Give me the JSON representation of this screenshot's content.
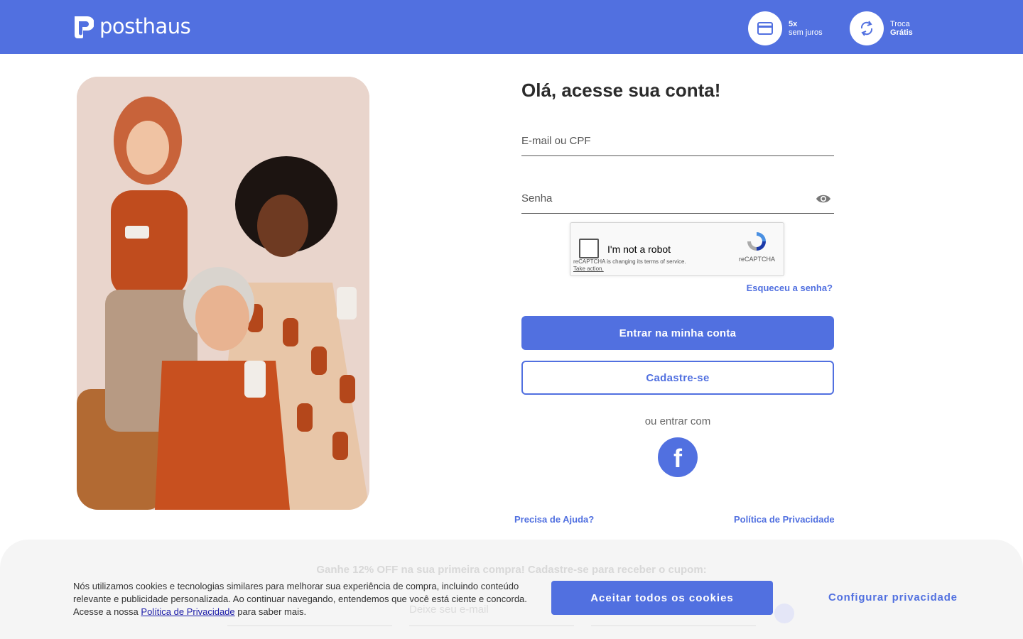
{
  "header": {
    "logo_text": "posthaus",
    "perks": [
      {
        "icon": "credit-card-icon",
        "line1": "5x",
        "line2": "sem juros"
      },
      {
        "icon": "exchange-icon",
        "line1": "Troca",
        "line2": "Grátis"
      }
    ],
    "brand_color": "#5170e0"
  },
  "hero": {
    "image": "three-women-holding-smartphones"
  },
  "login": {
    "title": "Olá, acesse sua conta!",
    "email_placeholder": "E-mail ou CPF",
    "email_value": "",
    "password_placeholder": "Senha",
    "password_value": "",
    "recaptcha": {
      "label": "I'm not a robot",
      "brand": "reCAPTCHA",
      "note": "reCAPTCHA is changing its terms of service.",
      "note_link": "Take action."
    },
    "forgot_label": "Esqueceu a senha?",
    "submit_label": "Entrar na minha conta",
    "register_label": "Cadastre-se",
    "alt_label": "ou entrar com",
    "facebook_glyph": "f"
  },
  "footer_links": {
    "help": "Precisa de Ajuda?",
    "privacy": "Política de Privacidade"
  },
  "newsletter": {
    "title": "Ganhe 12% OFF na sua primeira compra! Cadastre-se para receber o cupom:",
    "email_placeholder": "Deixe seu e-mail"
  },
  "cookie": {
    "text": "Nós utilizamos cookies e tecnologias similares para melhorar sua experiência de compra, incluindo conteúdo relevante e publicidade personalizada. Ao continuar navegando, entendemos que você está ciente e concorda. Acesse a nossa",
    "link": "Política de Privacidade",
    "suffix": "para saber mais.",
    "accept_label": "Aceitar todos os cookies",
    "config_label": "Configurar privacidade"
  }
}
